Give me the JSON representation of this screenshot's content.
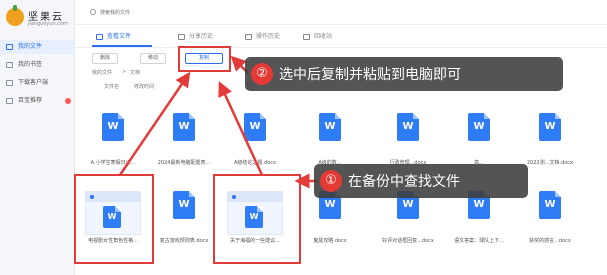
{
  "app": {
    "name": "坚果云",
    "domain": "jianguoyun.com"
  },
  "sidebar": {
    "items": [
      {
        "label": "我的文件",
        "active": true
      },
      {
        "label": "我的书签",
        "active": false
      },
      {
        "label": "下载客户端",
        "active": false
      },
      {
        "label": "百宝推荐",
        "active": false,
        "badge": true
      }
    ]
  },
  "search": {
    "placeholder": "搜索我的文件"
  },
  "tabs": [
    {
      "label": "查看文件",
      "active": true
    },
    {
      "label": "分享历史",
      "active": false
    },
    {
      "label": "操作历史",
      "active": false
    },
    {
      "label": "回收站",
      "active": false
    }
  ],
  "toolbar": {
    "delete_label": "删除",
    "move_label": "移动",
    "copy_label": "复制"
  },
  "breadcrumb": {
    "root": "我的文件",
    "sep": ">",
    "current": "文档"
  },
  "columns": {
    "name": "文件名",
    "modified": "修改时间"
  },
  "files_row1": [
    {
      "name": "A.小学生寒假日记..."
    },
    {
      "name": "2024最新电脑配置表..."
    },
    {
      "name": "A级的数..."
    },
    {
      "name": "A级结论之题.docx"
    },
    {
      "name": "行政管理...docx"
    },
    {
      "name": "高..."
    },
    {
      "name": "2022测...文档.docx"
    }
  ],
  "files_row2": [
    {
      "name": "电视剧女性角色性格..."
    },
    {
      "name": "励志游戏规则表.docx"
    },
    {
      "name": "复古游戏规则表.docx"
    },
    {
      "name": "关于海福的一些建议..."
    },
    {
      "name": "鬼屋攻略.docx"
    },
    {
      "name": "好评对话框回复...docx"
    },
    {
      "name": "语文答案：球队上下..."
    },
    {
      "name": "获奖的感言...docx"
    }
  ],
  "callouts": [
    {
      "num": "①",
      "text": "在备份中查找文件"
    },
    {
      "num": "②",
      "text": "选中后复制并粘贴到电脑即可"
    }
  ],
  "colors": {
    "accent": "#2d6ff0",
    "highlight": "#e33a3a",
    "word_blue": "#2f7df6"
  }
}
